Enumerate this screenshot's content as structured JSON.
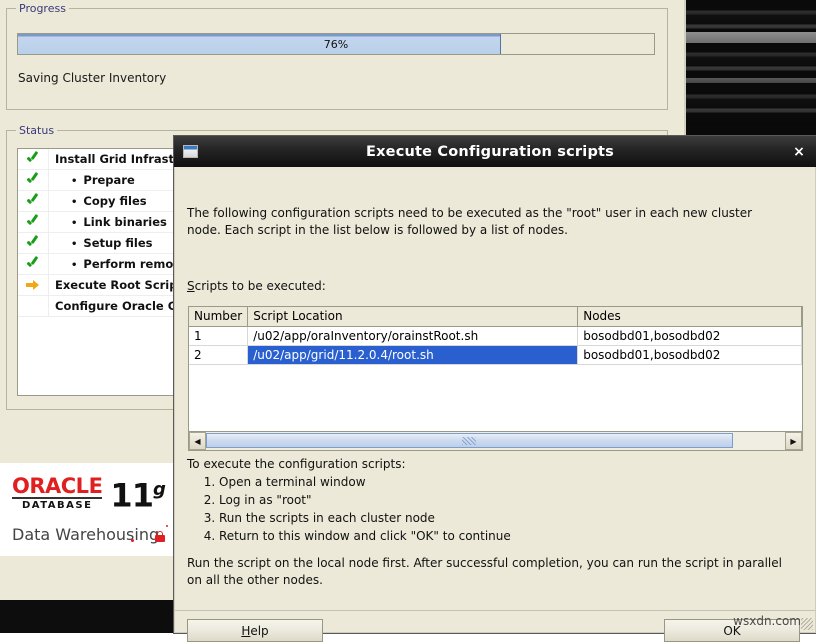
{
  "installer": {
    "progress_group": {
      "title": "Progress",
      "percent_label": "76%",
      "percent_value": 76,
      "status_text": "Saving Cluster Inventory"
    },
    "status_group": {
      "title": "Status",
      "items": [
        {
          "icon": "green-check-icon",
          "label": "Install Grid Infrastructure",
          "indent": false
        },
        {
          "icon": "green-check-icon",
          "label": "Prepare",
          "indent": true
        },
        {
          "icon": "green-check-icon",
          "label": "Copy files",
          "indent": true
        },
        {
          "icon": "green-check-icon",
          "label": "Link binaries",
          "indent": true
        },
        {
          "icon": "green-check-icon",
          "label": "Setup files",
          "indent": true
        },
        {
          "icon": "green-check-icon",
          "label": "Perform remote o",
          "indent": true
        },
        {
          "icon": "orange-arrow-icon",
          "label": "Execute Root Scripts",
          "indent": false
        },
        {
          "icon": "none",
          "label": "Configure Oracle Grid",
          "indent": false
        }
      ]
    },
    "branding": {
      "wordmark": "ORACLE",
      "rule_label": "DATABASE",
      "version": "11",
      "version_sup": "g",
      "tagline": "Data Warehousing",
      "lock_icon": "red-lock-icon"
    }
  },
  "dialog": {
    "window_icon": "window-icon",
    "title": "Execute Configuration scripts",
    "close_label": "×",
    "intro": "The following configuration scripts need to be executed as the \"root\" user in each new cluster node. Each script in the list below is followed by a list of nodes.",
    "scripts_label_mnemonic": "S",
    "scripts_label_rest": "cripts to be executed:",
    "table": {
      "columns": [
        "Number",
        "Script Location",
        "Nodes"
      ],
      "rows": [
        {
          "number": "1",
          "script": "/u02/app/oraInventory/orainstRoot.sh",
          "nodes": "bosodbd01,bosodbd02",
          "selected": false
        },
        {
          "number": "2",
          "script": "/u02/app/grid/11.2.0.4/root.sh",
          "nodes": "bosodbd01,bosodbd02",
          "selected": true
        }
      ]
    },
    "scrollbar": {
      "left_arrow": "◀",
      "right_arrow": "▶",
      "thumb_percent": 91
    },
    "instructions_heading": "To execute the configuration scripts:",
    "instructions": [
      "Open a terminal window",
      "Log in as \"root\"",
      "Run the scripts in each cluster node",
      "Return to this window and click \"OK\" to continue"
    ],
    "footer_note": "Run the script on the local node first. After successful completion, you can run the script in parallel on all the other nodes.",
    "buttons": {
      "help_mnemonic": "H",
      "help_rest": "elp",
      "ok_label": "OK"
    }
  },
  "watermark": "wsxdn.com",
  "colors": {
    "dialog_background": "#ece9d8",
    "titlebar_dark": "#1a1a1a",
    "selection_blue": "#2a5fd0",
    "progress_fill": "#b9cfea",
    "check_green": "#1a9e1a",
    "arrow_orange": "#f0a818",
    "oracle_red": "#e02020"
  }
}
